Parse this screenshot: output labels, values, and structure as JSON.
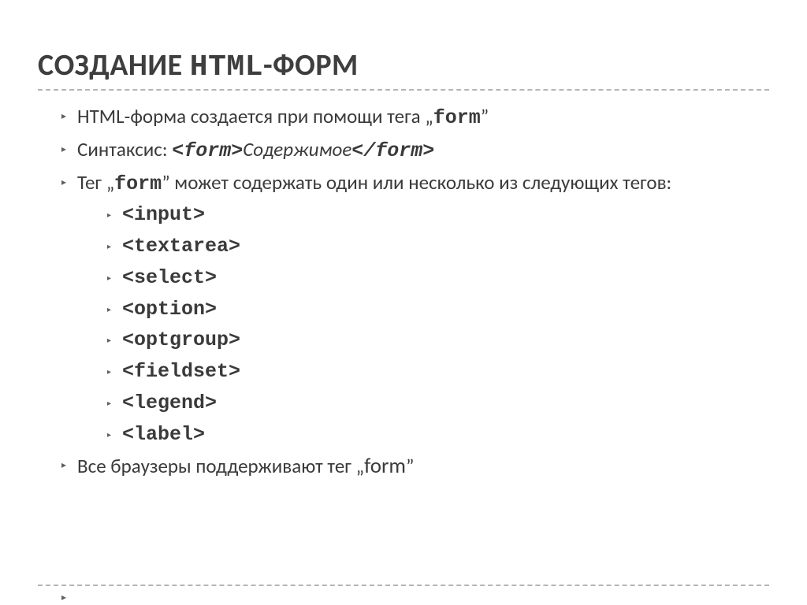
{
  "title": {
    "pre": "СОЗДАНИЕ ",
    "mono": "HTML",
    "post": "-ФОРМ"
  },
  "bullets": {
    "b1": {
      "pre": "HTML-форма создается при помощи тега  „",
      "tag": "form",
      "post": "”"
    },
    "b2": {
      "pre": "Синтаксис: ",
      "open": "<form>",
      "mid": "Содержимое",
      "close": "</form>"
    },
    "b3": {
      "pre": "Тег  „",
      "tag": "form",
      "post": "”  может содержать один или несколько из следующих тегов:"
    },
    "b4": {
      "pre": "Все браузеры поддерживают тег  „",
      "tag": "form",
      "post": "”"
    }
  },
  "subtags": [
    "<input>",
    "<textarea>",
    "<select>",
    "<option>",
    "<optgroup>",
    "<fieldset>",
    "<legend>",
    "<label>"
  ]
}
